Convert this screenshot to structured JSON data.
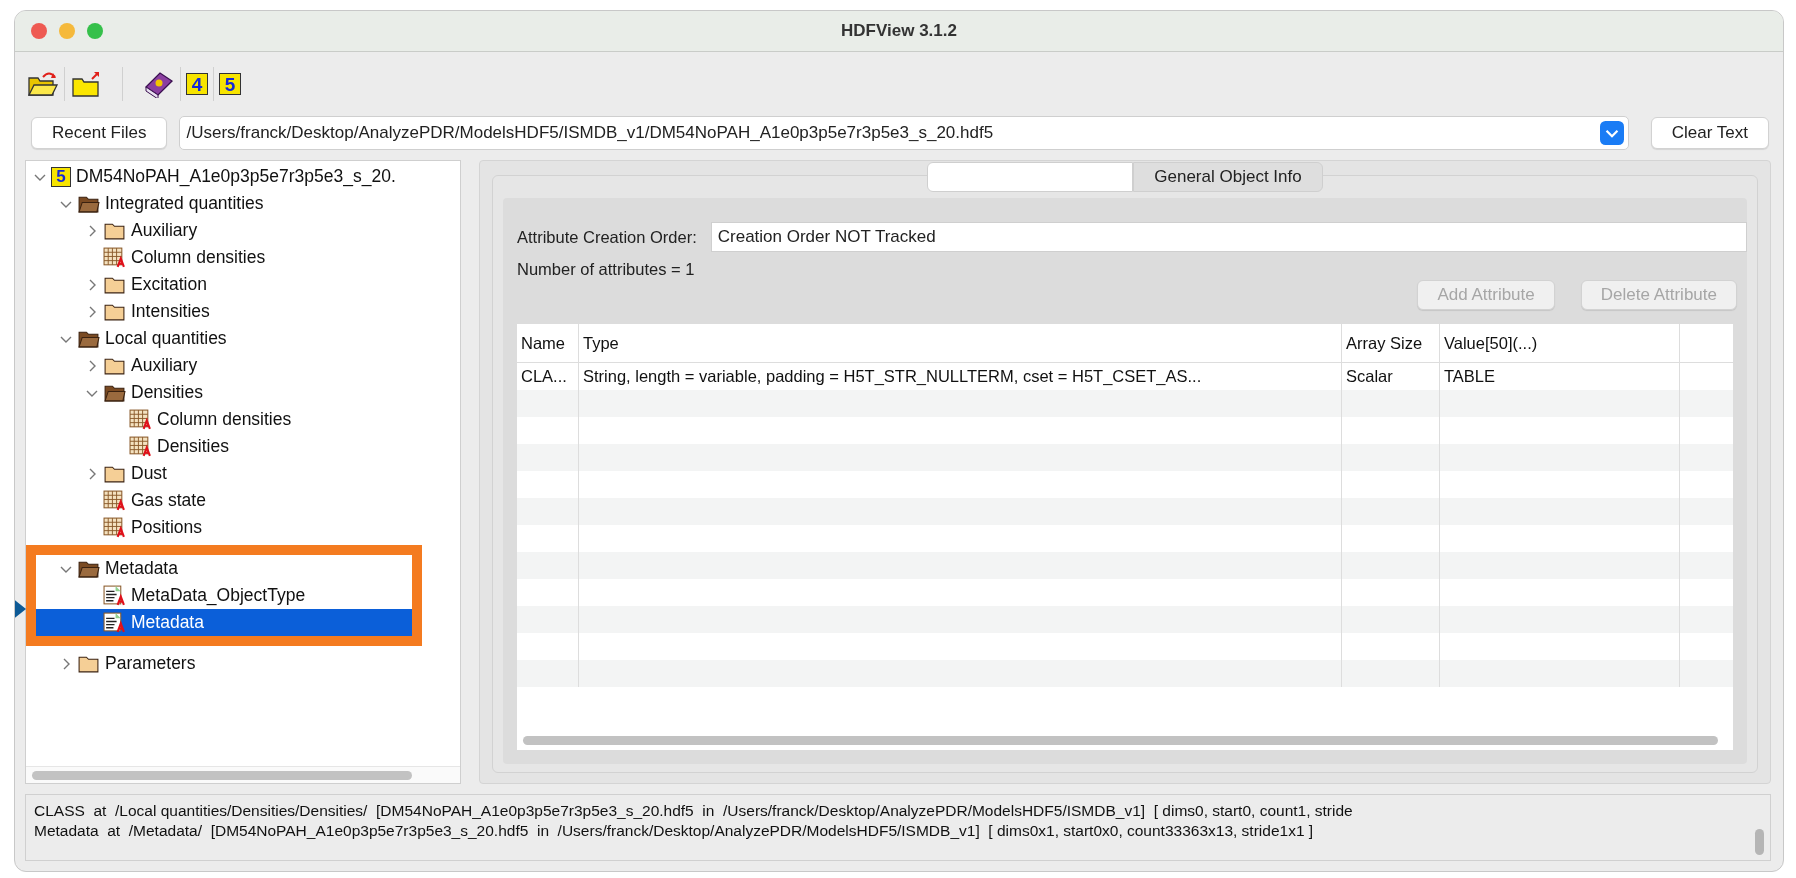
{
  "window": {
    "title": "HDFView 3.1.2"
  },
  "toolbar": [
    {
      "kind": "open"
    },
    {
      "kind": "close"
    },
    {
      "kind": "help"
    },
    {
      "kind": "hdf4",
      "label": "4"
    },
    {
      "kind": "hdf5",
      "label": "5"
    }
  ],
  "file_bar": {
    "recent_button": "Recent Files",
    "path": "/Users/franck/Desktop/AnalyzePDR/ModelsHDF5/ISMDB_v1/DM54NoPAH_A1e0p3p5e7r3p5e3_s_20.hdf5",
    "clear_button": "Clear Text"
  },
  "tree": {
    "root": {
      "label": "DM54NoPAH_A1e0p3p5e7r3p5e3_s_20.",
      "kind": "file",
      "icon_label": "5",
      "expanded": true,
      "selected": false,
      "children": [
        {
          "label": "Integrated quantities",
          "kind": "group",
          "expanded": true,
          "selected": false,
          "children": [
            {
              "label": "Auxiliary",
              "kind": "group",
              "expanded": false,
              "selected": false
            },
            {
              "label": "Column densities",
              "kind": "dataset",
              "selected": false
            },
            {
              "label": "Excitation",
              "kind": "group",
              "expanded": false,
              "selected": false
            },
            {
              "label": "Intensities",
              "kind": "group",
              "expanded": false,
              "selected": false
            }
          ]
        },
        {
          "label": "Local quantities",
          "kind": "group",
          "expanded": true,
          "selected": false,
          "children": [
            {
              "label": "Auxiliary",
              "kind": "group",
              "expanded": false,
              "selected": false
            },
            {
              "label": "Densities",
              "kind": "group",
              "expanded": true,
              "selected": false,
              "children": [
                {
                  "label": "Column densities",
                  "kind": "dataset",
                  "selected": false
                },
                {
                  "label": "Densities",
                  "kind": "dataset",
                  "selected": false
                }
              ]
            },
            {
              "label": "Dust",
              "kind": "group",
              "expanded": false,
              "selected": false
            },
            {
              "label": "Gas state",
              "kind": "dataset",
              "selected": false
            },
            {
              "label": "Positions",
              "kind": "dataset",
              "selected": false
            }
          ]
        },
        {
          "label": "Metadata",
          "kind": "group",
          "expanded": true,
          "selected": false,
          "annotated": true,
          "children": [
            {
              "label": "MetaData_ObjectType",
              "kind": "text",
              "selected": false
            },
            {
              "label": "Metadata",
              "kind": "text",
              "selected": true
            }
          ]
        },
        {
          "label": "Parameters",
          "kind": "group",
          "expanded": false,
          "selected": false
        }
      ]
    }
  },
  "info_panel": {
    "tabs": [
      {
        "selected": true
      },
      {
        "label": "General Object Info",
        "selected": false
      }
    ],
    "creation_order_label": "Attribute Creation Order:",
    "creation_order_value": "Creation Order NOT Tracked",
    "attribute_count": "Number of attributes = 1",
    "buttons": [
      {
        "label": "Add Attribute",
        "disabled": true
      },
      {
        "label": "Delete Attribute",
        "disabled": true
      }
    ],
    "table": {
      "columns": [
        "Name",
        "Type",
        "Array Size",
        "Value[50](...)"
      ],
      "rows": [
        [
          "CLA...",
          "String, length = variable, padding = H5T_STR_NULLTERM, cset = H5T_CSET_AS...",
          "Scalar",
          "TABLE"
        ]
      ]
    }
  },
  "status_log": [
    "CLASS  at  /Local quantities/Densities/Densities/  [DM54NoPAH_A1e0p3p5e7r3p5e3_s_20.hdf5  in  /Users/franck/Desktop/AnalyzePDR/ModelsHDF5/ISMDB_v1]  [ dims0, start0, count1, stride",
    "Metadata  at  /Metadata/  [DM54NoPAH_A1e0p3p5e7r3p5e3_s_20.hdf5  in  /Users/franck/Desktop/AnalyzePDR/ModelsHDF5/ISMDB_v1]  [ dims0x1, start0x0, count33363x13, stride1x1 ]"
  ]
}
